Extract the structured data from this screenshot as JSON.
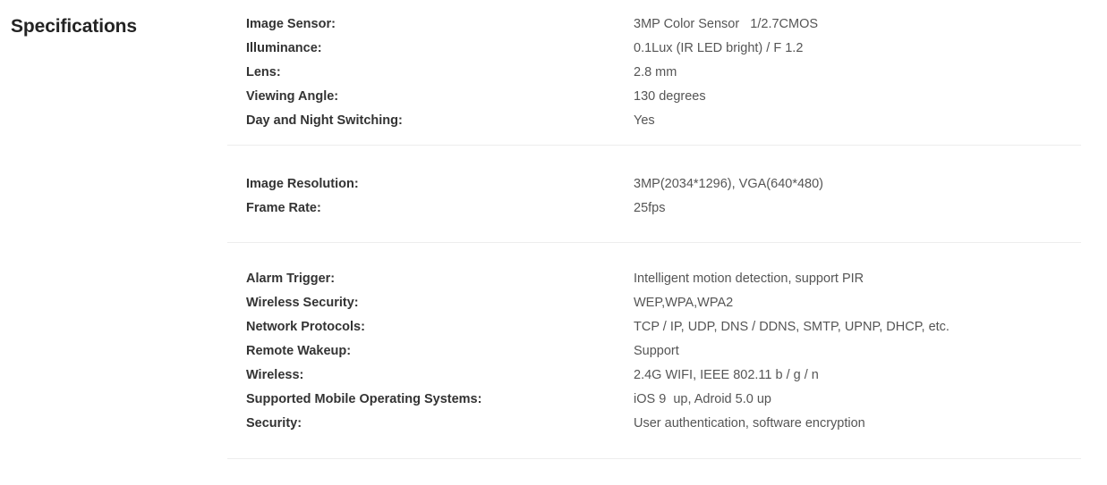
{
  "page": {
    "heading": "Specifications"
  },
  "colors": {
    "heading_text": "#232323",
    "label_text": "#333333",
    "value_text": "#555555",
    "divider": "#ededed",
    "background": "#ffffff"
  },
  "groups": [
    {
      "id": "imaging",
      "rows": [
        {
          "label": "Image Sensor:",
          "value": "3MP Color Sensor   1/2.7CMOS"
        },
        {
          "label": "Illuminance:",
          "value": "0.1Lux (IR LED bright) / F 1.2"
        },
        {
          "label": "Lens:",
          "value": "2.8 mm"
        },
        {
          "label": "Viewing Angle:",
          "value": "130 degrees"
        },
        {
          "label": "Day and Night Switching:",
          "value": "Yes"
        }
      ]
    },
    {
      "id": "video",
      "rows": [
        {
          "label": "Image Resolution:",
          "value": "3MP(2034*1296), VGA(640*480)"
        },
        {
          "label": "Frame Rate:",
          "value": "25fps"
        }
      ]
    },
    {
      "id": "network-and-security",
      "rows": [
        {
          "label": "Alarm Trigger:",
          "value": "Intelligent motion detection, support PIR"
        },
        {
          "label": "Wireless Security:",
          "value": "WEP,WPA,WPA2"
        },
        {
          "label": "Network Protocols:",
          "value": "TCP / IP, UDP, DNS / DDNS, SMTP, UPNP, DHCP, etc."
        },
        {
          "label": "Remote Wakeup:",
          "value": "Support"
        },
        {
          "label": "Wireless:",
          "value": "2.4G WIFI, IEEE 802.11 b / g / n"
        },
        {
          "label": "Supported Mobile Operating Systems:",
          "value": "iOS 9  up, Adroid 5.0 up"
        },
        {
          "label": "Security:",
          "value": "User authentication, software encryption"
        }
      ]
    }
  ]
}
